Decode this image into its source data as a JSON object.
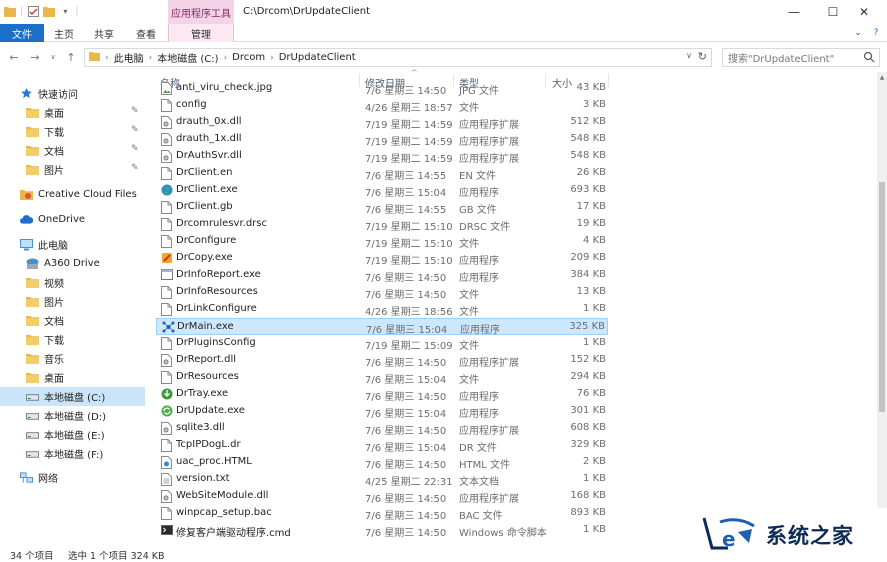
{
  "window": {
    "title": "C:\\Drcom\\DrUpdateClient",
    "context_tab": "应用程序工具",
    "minimize": "—",
    "maximize": "☐",
    "close": "✕"
  },
  "ribbon": {
    "tabs": [
      {
        "label": "文件"
      },
      {
        "label": "主页"
      },
      {
        "label": "共享"
      },
      {
        "label": "查看"
      },
      {
        "label": "管理"
      }
    ]
  },
  "address": {
    "crumbs": [
      "此电脑",
      "本地磁盘 (C:)",
      "Drcom",
      "DrUpdateClient"
    ],
    "search_placeholder": "搜索\"DrUpdateClient\""
  },
  "columns": {
    "name": "名称",
    "date": "修改日期",
    "type": "类型",
    "size": "大小"
  },
  "sidebar": {
    "items": [
      {
        "label": "快速访问",
        "icon": "star-icon",
        "color": "#2b79d6"
      },
      {
        "label": "桌面",
        "icon": "folder-icon",
        "color": "#e8b84a"
      },
      {
        "label": "下载",
        "icon": "download-folder-icon",
        "color": "#e8b84a"
      },
      {
        "label": "文档",
        "icon": "documents-folder-icon",
        "color": "#e8b84a"
      },
      {
        "label": "图片",
        "icon": "pictures-folder-icon",
        "color": "#e8b84a"
      },
      {
        "label": "Creative Cloud Files",
        "icon": "creative-cloud-icon",
        "color": "#e2533b"
      },
      {
        "label": "OneDrive",
        "icon": "cloud-icon",
        "color": "#1f6fd0"
      },
      {
        "label": "此电脑",
        "icon": "computer-icon",
        "color": "#4a8fd6"
      },
      {
        "label": "A360 Drive",
        "icon": "a360-drive-icon",
        "color": "#4a90c8"
      },
      {
        "label": "视频",
        "icon": "videos-folder-icon",
        "color": "#e8b84a"
      },
      {
        "label": "图片",
        "icon": "pictures-folder-icon",
        "color": "#e8b84a"
      },
      {
        "label": "文档",
        "icon": "documents-folder-icon",
        "color": "#e8b84a"
      },
      {
        "label": "下载",
        "icon": "download-folder-icon",
        "color": "#e8b84a"
      },
      {
        "label": "音乐",
        "icon": "music-folder-icon",
        "color": "#e8b84a"
      },
      {
        "label": "桌面",
        "icon": "folder-icon",
        "color": "#e8b84a"
      },
      {
        "label": "本地磁盘 (C:)",
        "icon": "drive-icon",
        "color": "#6a7f99"
      },
      {
        "label": "本地磁盘 (D:)",
        "icon": "drive-icon",
        "color": "#7a7a7a"
      },
      {
        "label": "本地磁盘 (E:)",
        "icon": "drive-icon",
        "color": "#7a7a7a"
      },
      {
        "label": "本地磁盘 (F:)",
        "icon": "drive-icon",
        "color": "#7a7a7a"
      },
      {
        "label": "网络",
        "icon": "network-icon",
        "color": "#4a8fd6"
      }
    ]
  },
  "files": [
    {
      "name": "anti_viru_check.jpg",
      "date": "7/6 星期三 14:50",
      "type": "JPG 文件",
      "size": "43 KB",
      "icon": "image-file-icon"
    },
    {
      "name": "config",
      "date": "4/26 星期三 18:57",
      "type": "文件",
      "size": "3 KB",
      "icon": "file-icon"
    },
    {
      "name": "drauth_0x.dll",
      "date": "7/19 星期二 14:59",
      "type": "应用程序扩展",
      "size": "512 KB",
      "icon": "dll-file-icon"
    },
    {
      "name": "drauth_1x.dll",
      "date": "7/19 星期二 14:59",
      "type": "应用程序扩展",
      "size": "548 KB",
      "icon": "dll-file-icon"
    },
    {
      "name": "DrAuthSvr.dll",
      "date": "7/19 星期二 14:59",
      "type": "应用程序扩展",
      "size": "548 KB",
      "icon": "dll-file-icon"
    },
    {
      "name": "DrClient.en",
      "date": "7/6 星期三 14:55",
      "type": "EN 文件",
      "size": "26 KB",
      "icon": "file-icon"
    },
    {
      "name": "DrClient.exe",
      "date": "7/6 星期三 15:04",
      "type": "应用程序",
      "size": "693 KB",
      "icon": "globe-app-icon"
    },
    {
      "name": "DrClient.gb",
      "date": "7/6 星期三 14:55",
      "type": "GB 文件",
      "size": "17 KB",
      "icon": "file-icon"
    },
    {
      "name": "Drcomrulesvr.drsc",
      "date": "7/19 星期二 15:10",
      "type": "DRSC 文件",
      "size": "19 KB",
      "icon": "file-icon"
    },
    {
      "name": "DrConfigure",
      "date": "7/19 星期二 15:10",
      "type": "文件",
      "size": "4 KB",
      "icon": "file-icon"
    },
    {
      "name": "DrCopy.exe",
      "date": "7/19 星期二 15:10",
      "type": "应用程序",
      "size": "209 KB",
      "icon": "copy-app-icon"
    },
    {
      "name": "DrInfoReport.exe",
      "date": "7/6 星期三 14:50",
      "type": "应用程序",
      "size": "384 KB",
      "icon": "app-window-icon"
    },
    {
      "name": "DrInfoResources",
      "date": "7/6 星期三 14:50",
      "type": "文件",
      "size": "13 KB",
      "icon": "file-icon"
    },
    {
      "name": "DrLinkConfigure",
      "date": "4/26 星期三 18:56",
      "type": "文件",
      "size": "1 KB",
      "icon": "file-icon"
    },
    {
      "name": "DrMain.exe",
      "date": "7/6 星期三 15:04",
      "type": "应用程序",
      "size": "325 KB",
      "icon": "network-app-icon"
    },
    {
      "name": "DrPluginsConfig",
      "date": "7/19 星期二 15:09",
      "type": "文件",
      "size": "1 KB",
      "icon": "file-icon"
    },
    {
      "name": "DrReport.dll",
      "date": "7/6 星期三 14:50",
      "type": "应用程序扩展",
      "size": "152 KB",
      "icon": "dll-file-icon"
    },
    {
      "name": "DrResources",
      "date": "7/6 星期三 15:04",
      "type": "文件",
      "size": "294 KB",
      "icon": "file-icon"
    },
    {
      "name": "DrTray.exe",
      "date": "7/6 星期三 14:50",
      "type": "应用程序",
      "size": "76 KB",
      "icon": "tray-app-icon"
    },
    {
      "name": "DrUpdate.exe",
      "date": "7/6 星期三 15:04",
      "type": "应用程序",
      "size": "301 KB",
      "icon": "update-app-icon"
    },
    {
      "name": "sqlite3.dll",
      "date": "7/6 星期三 14:50",
      "type": "应用程序扩展",
      "size": "608 KB",
      "icon": "dll-file-icon"
    },
    {
      "name": "TcpIPDogL.dr",
      "date": "7/6 星期三 15:04",
      "type": "DR 文件",
      "size": "329 KB",
      "icon": "file-icon"
    },
    {
      "name": "uac_proc.HTML",
      "date": "7/6 星期三 14:50",
      "type": "HTML 文件",
      "size": "2 KB",
      "icon": "html-file-icon"
    },
    {
      "name": "version.txt",
      "date": "4/25 星期二 22:31",
      "type": "文本文档",
      "size": "1 KB",
      "icon": "text-file-icon"
    },
    {
      "name": "WebSiteModule.dll",
      "date": "7/6 星期三 14:50",
      "type": "应用程序扩展",
      "size": "168 KB",
      "icon": "dll-file-icon"
    },
    {
      "name": "winpcap_setup.bac",
      "date": "7/6 星期三 14:50",
      "type": "BAC 文件",
      "size": "893 KB",
      "icon": "file-icon"
    },
    {
      "name": "修复客户端驱动程序.cmd",
      "date": "7/6 星期三 14:50",
      "type": "Windows 命令脚本",
      "size": "1 KB",
      "icon": "cmd-file-icon"
    }
  ],
  "selected_file": "DrMain.exe",
  "status": {
    "count": "34 个项目",
    "selection": "选中 1 个项目  324 KB"
  },
  "watermark": {
    "text": "系统之家"
  },
  "colors": {
    "accent": "#1a6fc9",
    "selection": "#cce8ff",
    "context_tab": "#f3d3e6"
  }
}
